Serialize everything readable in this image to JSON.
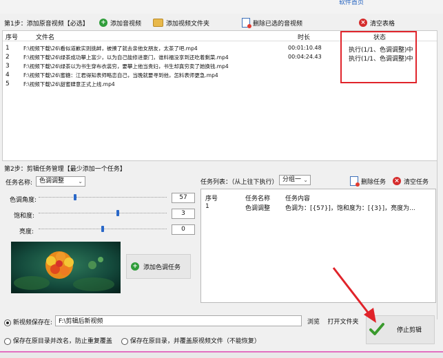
{
  "top": {
    "help_link": "软件首页"
  },
  "step1": {
    "label": "第1步：添加原音视频【必选】",
    "add_video": "添加音视频",
    "add_folder": "添加视频文件夹",
    "delete_selected": "删除已选的音视频",
    "clear_table": "清空表格"
  },
  "file_table": {
    "headers": {
      "index": "序号",
      "filename": "文件名",
      "duration": "时长",
      "status": "状态"
    },
    "rows": [
      {
        "index": "1",
        "filename": "F:\\视频下载\\26\\看似道歉实则挑衅，被揍了就去亲他女朋友，太茶了吧.mp4",
        "duration": "00:01:10.48",
        "status": "执行(1/1、色调调整)中"
      },
      {
        "index": "2",
        "filename": "F:\\视频下载\\26\\绿茶成功攀上富少，以为自己能修进豪门，谁料福没享到还吃着剩菜.mp4",
        "duration": "00:04:24.43",
        "status": "执行(1/1、色调调整)中"
      },
      {
        "index": "3",
        "filename": "F:\\视频下载\\26\\绿茶以为书生穿布衣装穷，要攀上他当贵妇，书生却真穷卖了她换钱.mp4",
        "duration": "",
        "status": ""
      },
      {
        "index": "4",
        "filename": "F:\\视频下载\\26\\蜜糖：江君得知表师略恋自己，当晚就要寻到他，怎料表师更急.mp4",
        "duration": "",
        "status": ""
      },
      {
        "index": "5",
        "filename": "F:\\视频下载\\26\\甜蜜肆意正式上线.mp4",
        "duration": "",
        "status": ""
      }
    ]
  },
  "step2": {
    "label": "第2步：剪辑任务管理【最少添加一个任务】",
    "task_name_label": "任务名称:",
    "task_name_value": "色调调整",
    "hue_label": "色调角度:",
    "hue_value": "57",
    "hue_fraction": 0.28,
    "saturation_label": "饱和度:",
    "saturation_value": "3",
    "saturation_fraction": 0.62,
    "brightness_label": "亮度:",
    "brightness_value": "0",
    "brightness_fraction": 0.5,
    "add_task_button": "添加色调任务"
  },
  "task_list": {
    "label": "任务列表：（从上往下执行）",
    "group_value": "分组一",
    "delete_task": "删除任务",
    "clear_tasks": "清空任务",
    "headers": {
      "index": "序号",
      "name": "任务名称",
      "content": "任务内容"
    },
    "rows": [
      {
        "index": "1",
        "name": "色调调整",
        "content": "色调为：[{57}]，饱和度为：[{3}]，亮度为..."
      }
    ]
  },
  "bottom": {
    "save_new_label": "新视频保存在:",
    "save_path": "F:\\剪辑后新视频",
    "browse": "浏览",
    "open_folder": "打开文件夹",
    "option_rename": "保存在原目录并改名，防止重复覆盖",
    "option_overwrite": "保存在原目录，并覆盖原视频文件（不能恢复）",
    "stop_button": "停止剪辑"
  },
  "colors": {
    "accent_red": "#e0232a",
    "blue_thumb": "#2a68c8",
    "green_icon": "#2f9d3a",
    "pink_bar": "#e26fc0"
  }
}
